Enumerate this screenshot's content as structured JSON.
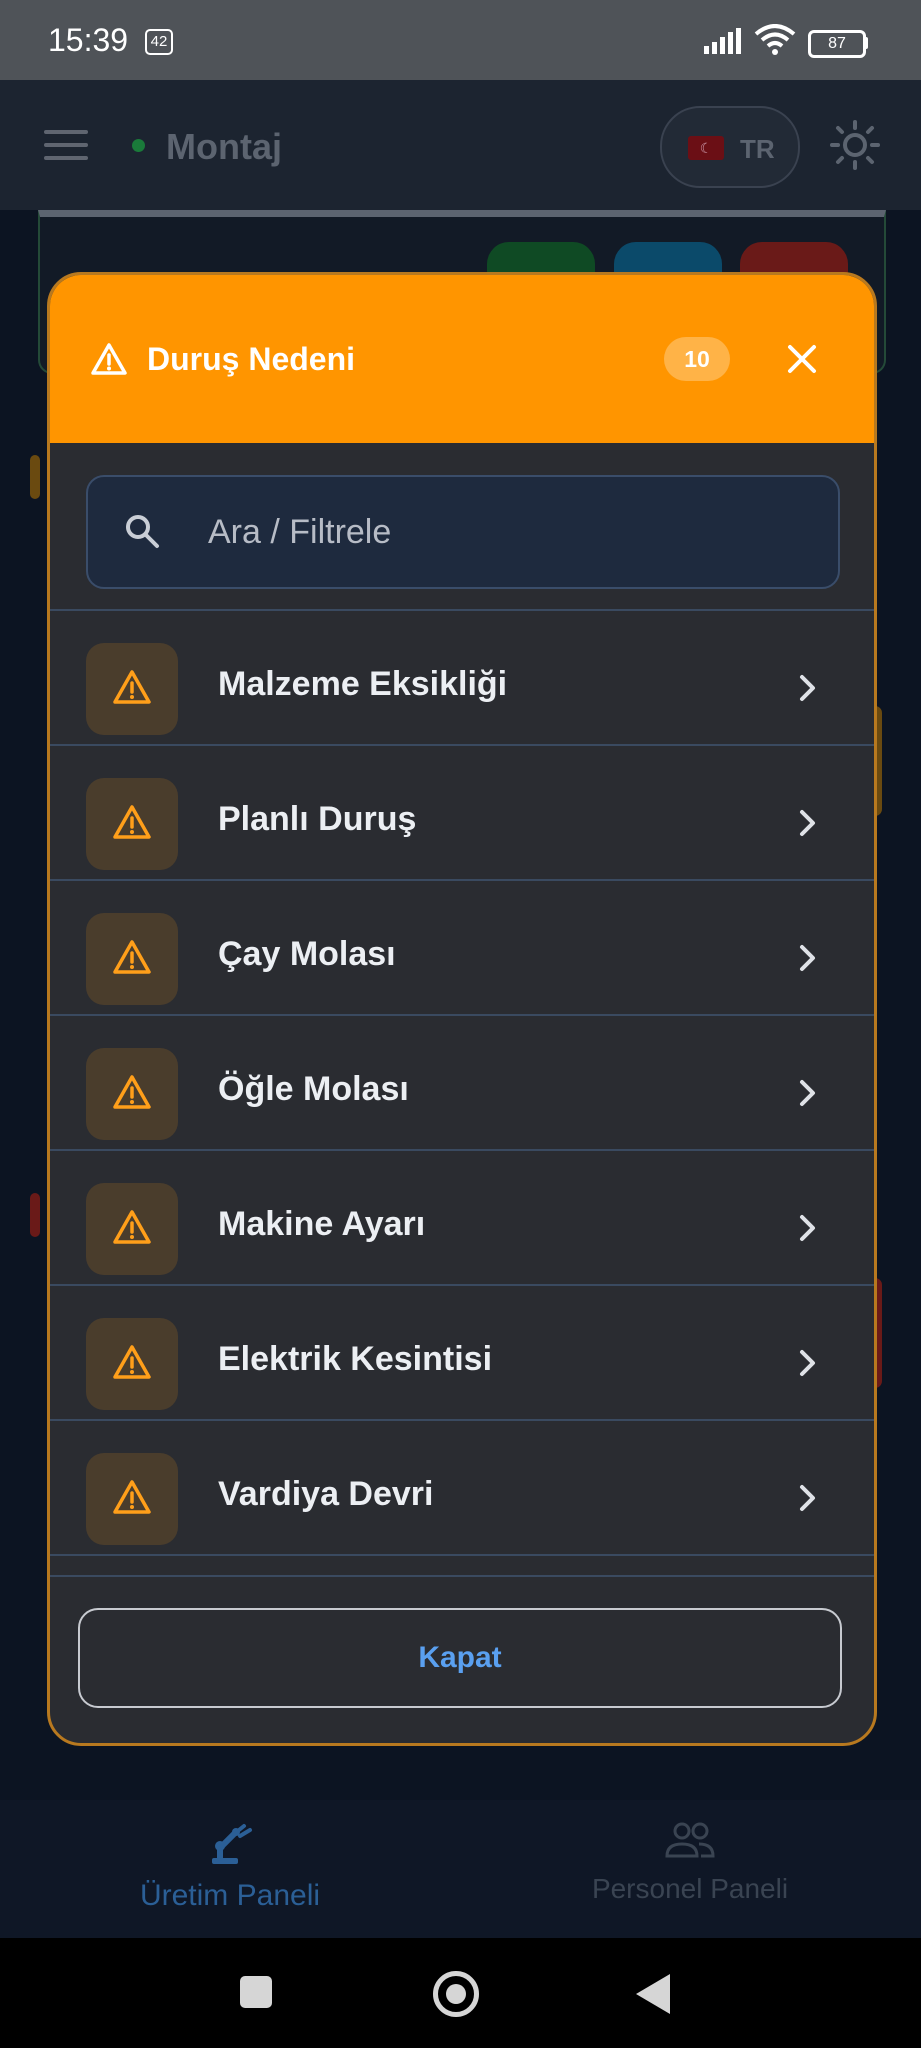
{
  "status_bar": {
    "time": "15:39",
    "notification_count": "42",
    "battery": "87"
  },
  "app_bar": {
    "title": "Montaj",
    "lang_code": "TR"
  },
  "modal": {
    "title": "Duruş Nedeni",
    "count": "10",
    "search_placeholder": "Ara / Filtrele",
    "items": [
      {
        "label": "Malzeme Eksikliği"
      },
      {
        "label": "Planlı Duruş"
      },
      {
        "label": "Çay Molası"
      },
      {
        "label": "Öğle Molası"
      },
      {
        "label": "Makine Ayarı"
      },
      {
        "label": "Elektrik Kesintisi"
      },
      {
        "label": "Vardiya Devri"
      }
    ],
    "close_label": "Kapat"
  },
  "bottom_nav": {
    "items": [
      {
        "label": "Üretim Paneli",
        "icon": "robot-arm-icon",
        "active": true
      },
      {
        "label": "Personel Paneli",
        "icon": "people-icon",
        "active": false
      }
    ]
  },
  "colors": {
    "accent": "#ff9500",
    "link": "#5aa0f0",
    "background": "#0c1422"
  }
}
